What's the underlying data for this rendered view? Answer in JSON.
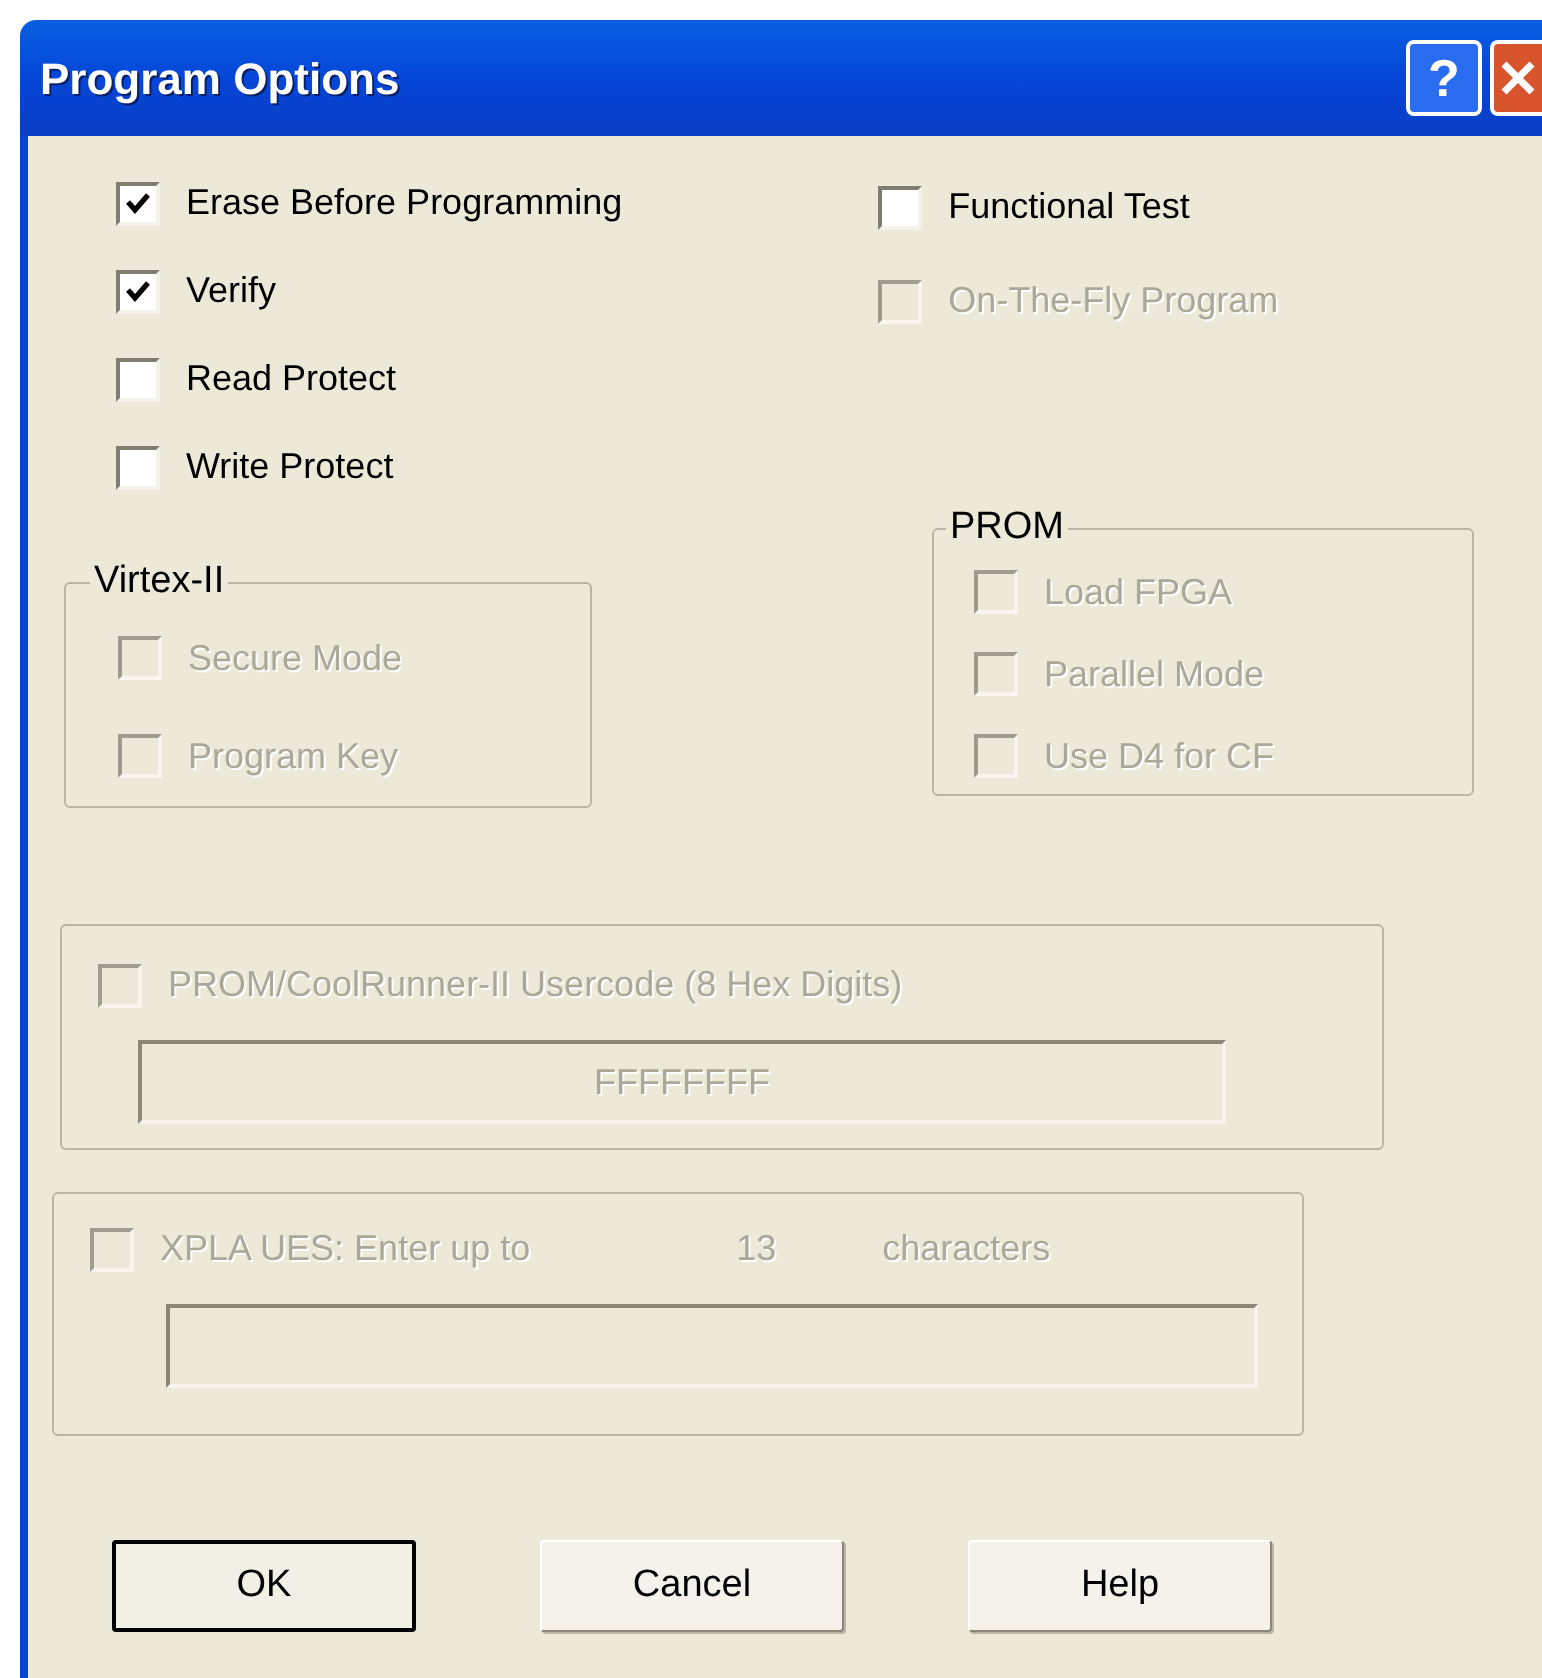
{
  "window": {
    "title": "Program Options"
  },
  "help_button": {
    "label": "?"
  },
  "options_left": [
    {
      "label": "Erase Before Programming",
      "checked": true,
      "disabled": false
    },
    {
      "label": "Verify",
      "checked": true,
      "disabled": false
    },
    {
      "label": "Read Protect",
      "checked": false,
      "disabled": false
    },
    {
      "label": "Write Protect",
      "checked": false,
      "disabled": false
    }
  ],
  "options_right": [
    {
      "label": "Functional Test",
      "checked": false,
      "disabled": false
    },
    {
      "label": "On-The-Fly Program",
      "checked": false,
      "disabled": true
    }
  ],
  "virtex_group": {
    "title": "Virtex-II",
    "options": [
      {
        "label": "Secure Mode",
        "checked": false,
        "disabled": true
      },
      {
        "label": "Program Key",
        "checked": false,
        "disabled": true
      }
    ]
  },
  "prom_group": {
    "title": "PROM",
    "options": [
      {
        "label": "Load FPGA",
        "checked": false,
        "disabled": true
      },
      {
        "label": "Parallel Mode",
        "checked": false,
        "disabled": true
      },
      {
        "label": "Use D4 for CF",
        "checked": false,
        "disabled": true
      }
    ]
  },
  "usercode": {
    "label": "PROM/CoolRunner-II Usercode (8 Hex Digits)",
    "checked": false,
    "disabled": true,
    "value": "FFFFFFFF"
  },
  "xpla": {
    "label": "XPLA UES: Enter up to",
    "count": "13",
    "unit": "characters",
    "checked": false,
    "disabled": true
  },
  "buttons": [
    {
      "label": "OK",
      "default": true
    },
    {
      "label": "Cancel",
      "default": false
    },
    {
      "label": "Help",
      "default": false
    }
  ]
}
